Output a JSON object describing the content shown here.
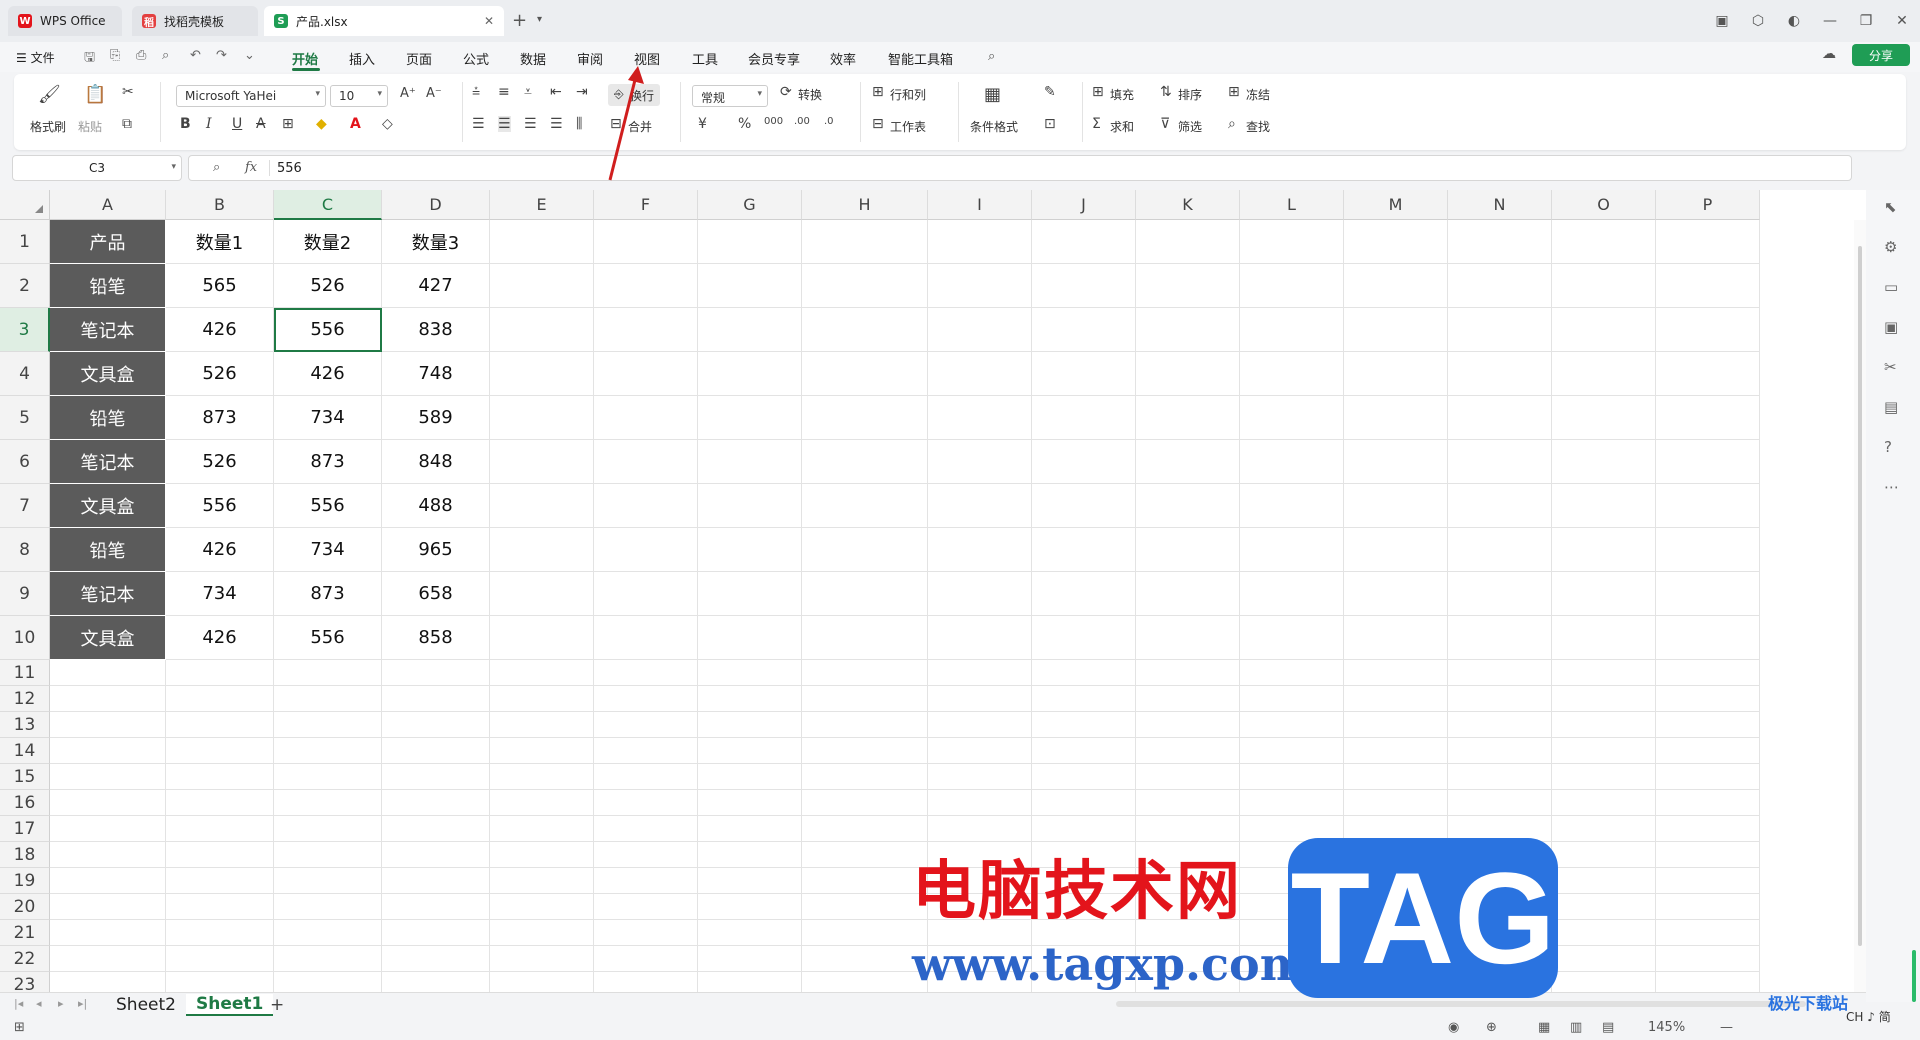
{
  "tabs": [
    {
      "label": "WPS Office",
      "logo": "W",
      "logo_color": "#e3141b"
    },
    {
      "label": "找稻壳模板",
      "logo": "稻",
      "logo_color": "#e34040"
    },
    {
      "label": "产品.xlsx",
      "logo": "S",
      "logo_color": "#1f9d55"
    }
  ],
  "menu": {
    "file": "☰ 文件",
    "items": [
      "开始",
      "插入",
      "页面",
      "公式",
      "数据",
      "审阅",
      "视图",
      "工具",
      "会员专享",
      "效率",
      "智能工具箱"
    ],
    "active": "开始",
    "share": "分享"
  },
  "ribbon": {
    "format_painter": "格式刷",
    "paste": "粘贴",
    "font_name": "Microsoft YaHei",
    "font_size": "10",
    "wrap": "换行",
    "merge": "合并",
    "number_format": "常规",
    "convert": "转换",
    "rows_cols": "行和列",
    "worksheet": "工作表",
    "cond_format": "条件格式",
    "fill": "填充",
    "sort": "排序",
    "freeze": "冻结",
    "sum": "求和",
    "filter": "筛选",
    "find": "查找"
  },
  "formula_bar": {
    "name_box": "C3",
    "value": "556"
  },
  "columns": [
    "A",
    "B",
    "C",
    "D",
    "E",
    "F",
    "G",
    "H",
    "I",
    "J",
    "K",
    "L",
    "M",
    "N",
    "O",
    "P"
  ],
  "selected_column": "C",
  "selected_row": "3",
  "rows": [
    "1",
    "2",
    "3",
    "4",
    "5",
    "6",
    "7",
    "8",
    "9",
    "10",
    "11",
    "12",
    "13",
    "14",
    "15",
    "16",
    "17",
    "18",
    "19",
    "20",
    "21",
    "22",
    "23"
  ],
  "table": [
    [
      "产品",
      "数量1",
      "数量2",
      "数量3"
    ],
    [
      "铅笔",
      "565",
      "526",
      "427"
    ],
    [
      "笔记本",
      "426",
      "556",
      "838"
    ],
    [
      "文具盒",
      "526",
      "426",
      "748"
    ],
    [
      "铅笔",
      "873",
      "734",
      "589"
    ],
    [
      "笔记本",
      "526",
      "873",
      "848"
    ],
    [
      "文具盒",
      "556",
      "556",
      "488"
    ],
    [
      "铅笔",
      "426",
      "734",
      "965"
    ],
    [
      "笔记本",
      "734",
      "873",
      "658"
    ],
    [
      "文具盒",
      "426",
      "556",
      "858"
    ]
  ],
  "sheets": [
    "Sheet2",
    "Sheet1"
  ],
  "active_sheet": "Sheet1",
  "status": {
    "zoom": "145%",
    "ime": "CH ♪ 简"
  },
  "watermark": {
    "title": "电脑技术网",
    "url": "www.tagxp.com",
    "tag": "TAG",
    "site": "极光下载站"
  },
  "colors": {
    "accent": "#1f7a45",
    "header_fill": "#5b5b5b"
  }
}
